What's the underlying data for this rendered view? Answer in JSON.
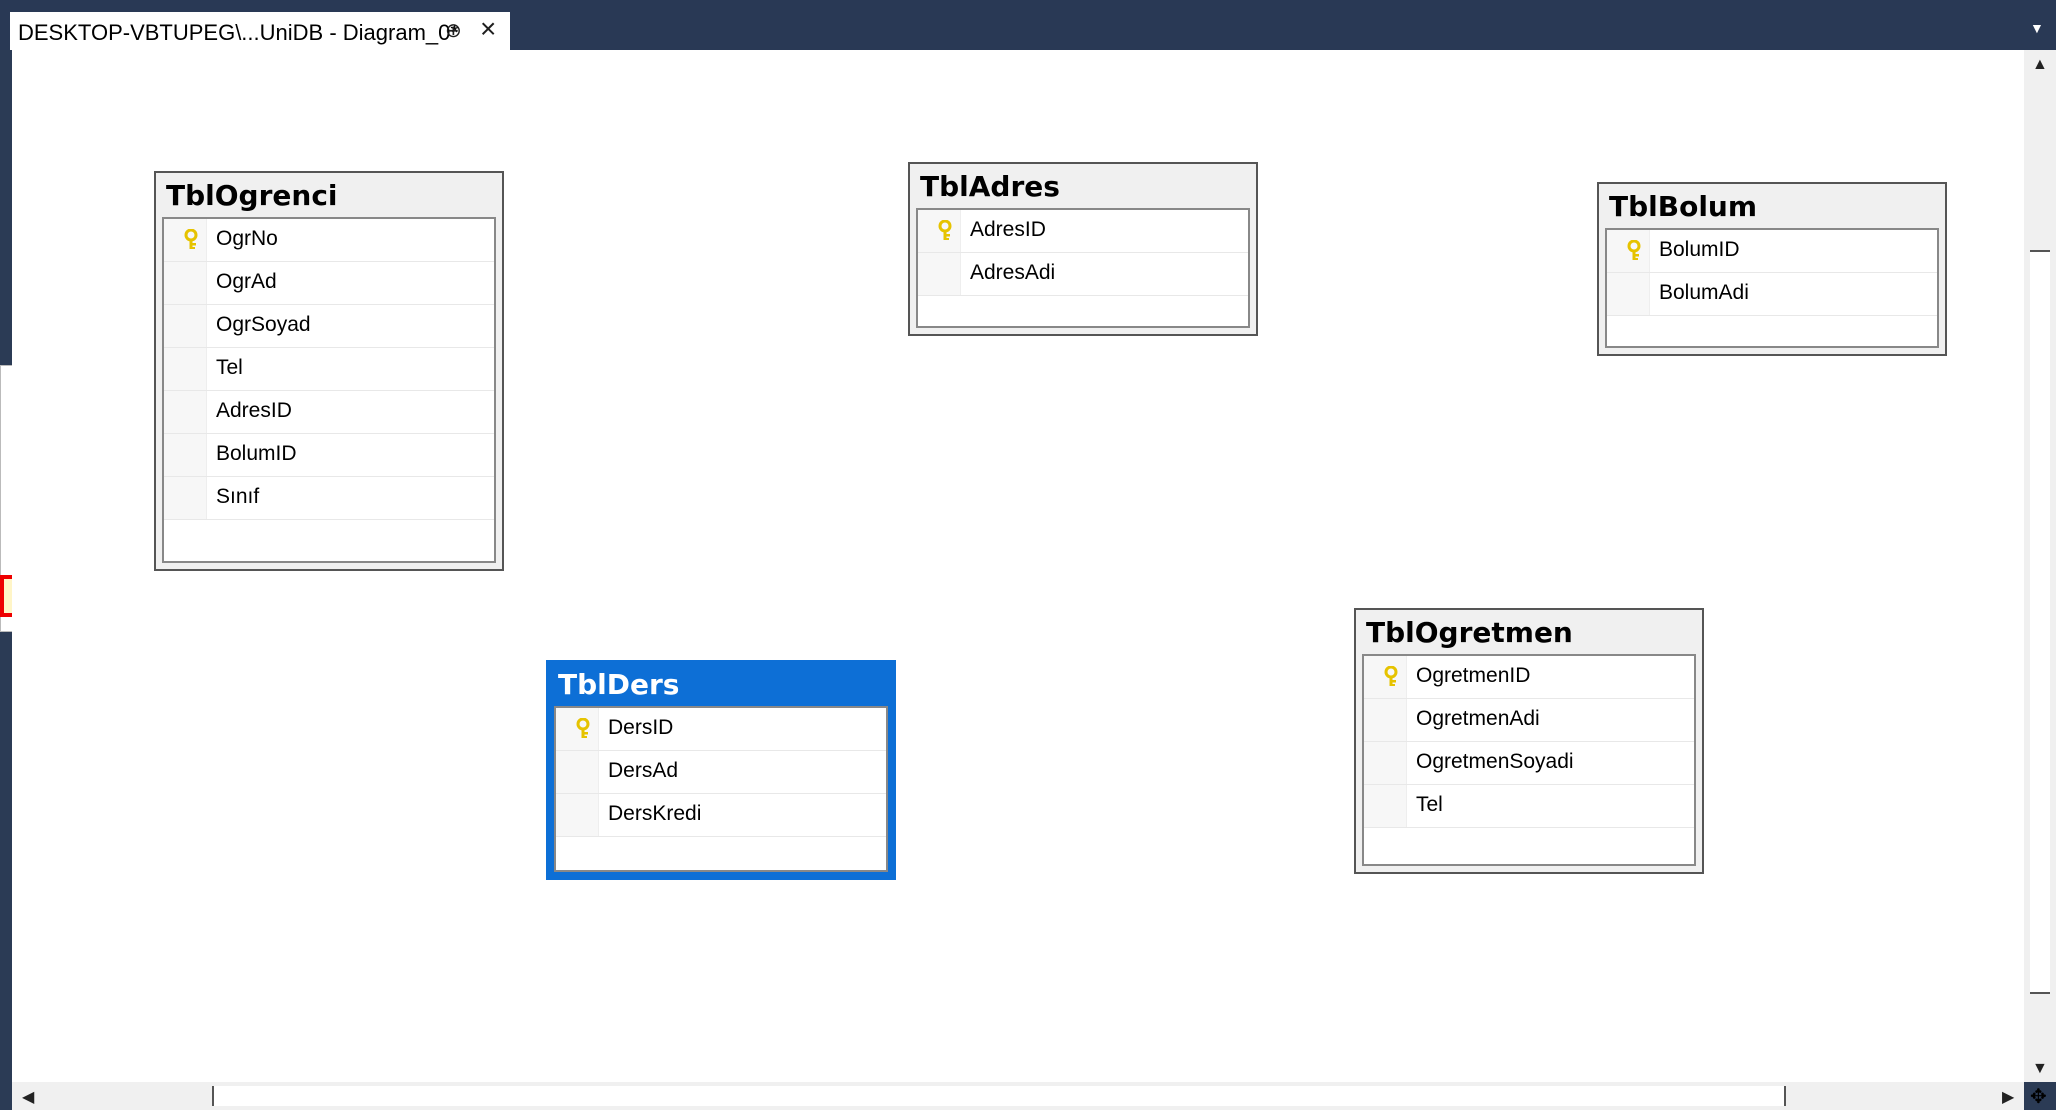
{
  "tab": {
    "title": "DESKTOP-VBTUPEG\\...UniDB - Diagram_0*",
    "pin_icon": "pin-icon",
    "close_icon": "close-icon"
  },
  "tables": [
    {
      "name": "TblOgrenci",
      "columns": [
        {
          "name": "OgrNo",
          "key": true
        },
        {
          "name": "OgrAd",
          "key": false
        },
        {
          "name": "OgrSoyad",
          "key": false
        },
        {
          "name": "Tel",
          "key": false
        },
        {
          "name": "AdresID",
          "key": false
        },
        {
          "name": "BolumID",
          "key": false
        },
        {
          "name": "Sınıf",
          "key": false
        }
      ]
    },
    {
      "name": "TblAdres",
      "columns": [
        {
          "name": "AdresID",
          "key": true
        },
        {
          "name": "AdresAdi",
          "key": false
        }
      ]
    },
    {
      "name": "TblBolum",
      "columns": [
        {
          "name": "BolumID",
          "key": true
        },
        {
          "name": "BolumAdi",
          "key": false
        }
      ]
    },
    {
      "name": "TblDers",
      "selected": true,
      "columns": [
        {
          "name": "DersID",
          "key": true
        },
        {
          "name": "DersAd",
          "key": false
        },
        {
          "name": "DersKredi",
          "key": false
        }
      ]
    },
    {
      "name": "TblOgretmen",
      "columns": [
        {
          "name": "OgretmenID",
          "key": true
        },
        {
          "name": "OgretmenAdi",
          "key": false
        },
        {
          "name": "OgretmenSoyadi",
          "key": false
        },
        {
          "name": "Tel",
          "key": false
        }
      ]
    }
  ],
  "colors": {
    "tab_bar": "#293955",
    "selected_table": "#0d6fd6",
    "key_icon": "#e6c300"
  }
}
